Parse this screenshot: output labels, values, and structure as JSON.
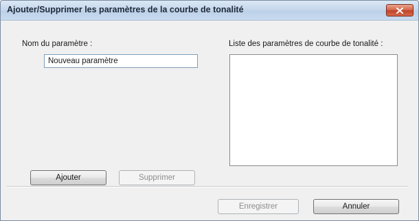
{
  "window": {
    "title": "Ajouter/Supprimer les paramètres de la courbe de tonalité"
  },
  "icons": {
    "close": "close-icon"
  },
  "colors": {
    "close_button": "#c9503a",
    "titlebar": "#c7d8ec",
    "dialog_background": "#f0f0f0"
  },
  "form": {
    "name_label": "Nom du paramètre :",
    "name_value": "Nouveau paramètre",
    "list_label": "Liste des paramètres de courbe de tonalité :",
    "list_items": []
  },
  "buttons": {
    "add": "Ajouter",
    "delete": "Supprimer",
    "save": "Enregistrer",
    "cancel": "Annuler"
  }
}
